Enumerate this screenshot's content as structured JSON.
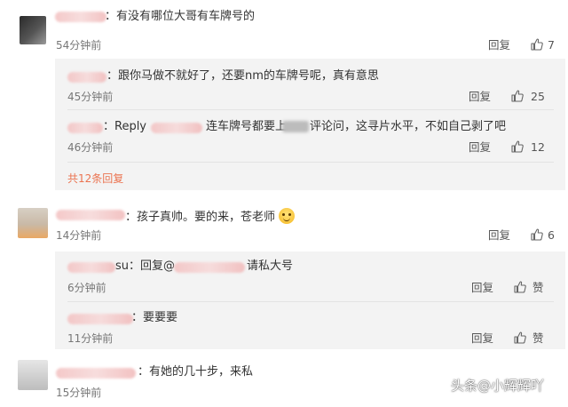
{
  "comments": [
    {
      "text": "：有没有哪位大哥有车牌号的",
      "time": "54分钟前",
      "reply_label": "回复",
      "likes": "7",
      "replies": [
        {
          "text": "：跟你马做不就好了，还要nm的车牌号呢，真有意思",
          "time": "45分钟前",
          "reply_label": "回复",
          "likes": "25"
        },
        {
          "text_a": "：Reply",
          "text_b": "连车牌号都要上",
          "text_c": "评论问，这寻片水平，不如自己剥了吧",
          "time": "46分钟前",
          "reply_label": "回复",
          "likes": "12"
        }
      ],
      "more_label": "共12条回复"
    },
    {
      "text": "：孩子真帅。要的来，苍老师",
      "time": "14分钟前",
      "reply_label": "回复",
      "likes": "6",
      "replies": [
        {
          "text_a": "su：回复@",
          "text_b": "请私大号",
          "time": "6分钟前",
          "reply_label": "回复",
          "likes": "赞"
        },
        {
          "text": "：要要要",
          "time": "11分钟前",
          "reply_label": "回复",
          "likes": "赞"
        }
      ]
    },
    {
      "text": "：有她的几十步，来私",
      "time": "15分钟前"
    }
  ],
  "watermark": {
    "prefix": "头条",
    "handle": "@小辉辉吖"
  },
  "icons": {
    "like": "thumbs-up-icon",
    "emoji": "smile-emoji-icon"
  },
  "colors": {
    "more_link": "#eb7350",
    "sub_bg": "#f3f3f3"
  }
}
